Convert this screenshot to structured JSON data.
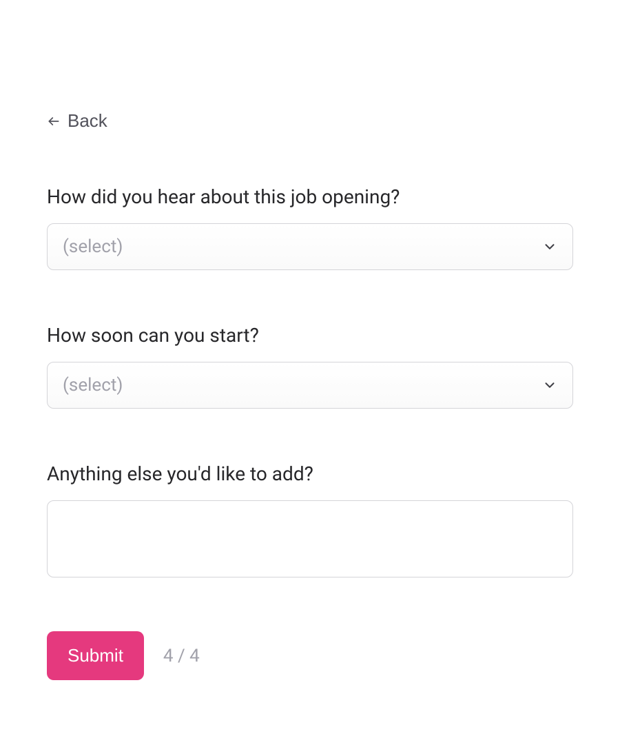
{
  "nav": {
    "back_label": "Back"
  },
  "form": {
    "fields": [
      {
        "label": "How did you hear about this job opening?",
        "placeholder": "(select)"
      },
      {
        "label": "How soon can you start?",
        "placeholder": "(select)"
      },
      {
        "label": "Anything else you'd like to add?"
      }
    ],
    "submit_label": "Submit",
    "step_indicator": "4 / 4"
  }
}
